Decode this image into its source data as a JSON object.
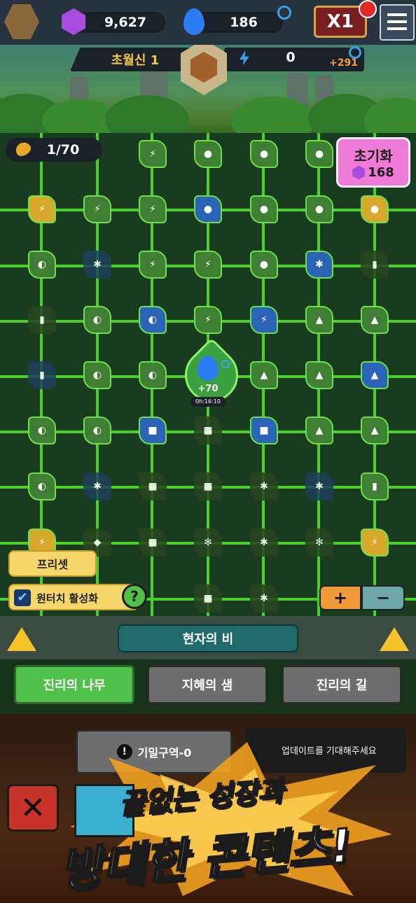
{
  "top": {
    "gems": "9,627",
    "flames": "186",
    "speed": "X1"
  },
  "stage": {
    "name": "초월신 1",
    "energy": "0",
    "energy_gain": "+291"
  },
  "grid": {
    "counter": "1/70",
    "reset_label": "초기화",
    "reset_cost": "168",
    "center_gain": "+70",
    "center_timer": "0h:16:10"
  },
  "controls": {
    "preset": "프리셋",
    "onetouch": "원터치 활성화",
    "help": "?",
    "plus": "+",
    "minus": "−"
  },
  "section_title": "현자의 비",
  "tabs": [
    "진리의 나무",
    "지혜의 샘",
    "진리의 길"
  ],
  "secret": "기밀구역-0",
  "notice": "업데이트를 기대해주세요",
  "promo": {
    "line1": "끝없는 성장과",
    "line2": "방대한 콘텐츠!"
  },
  "colors": {
    "accent": "#e05ad0",
    "node_green": "#3f7f33",
    "node_blue": "#2a64b7",
    "node_gold": "#d6a92a"
  }
}
